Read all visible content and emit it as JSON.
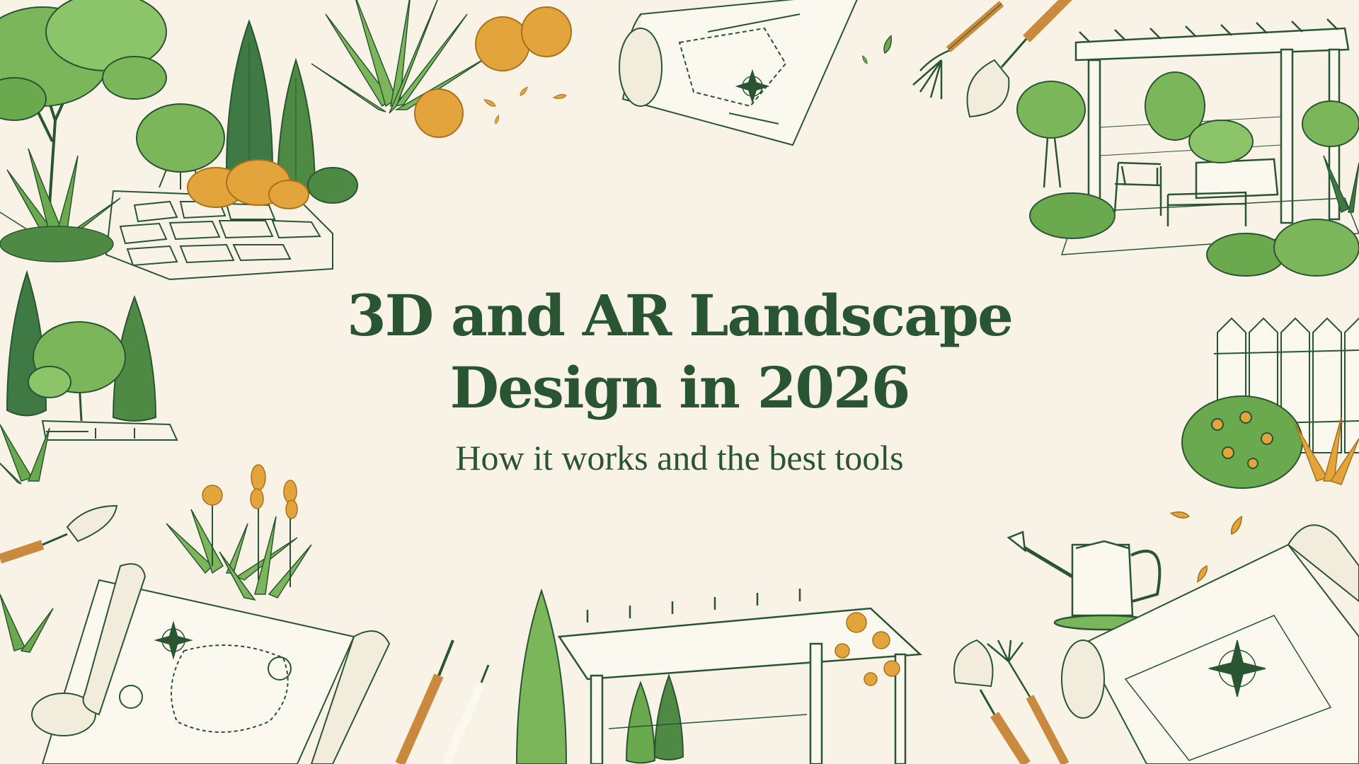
{
  "title": {
    "line1": "3D and AR Landscape",
    "line2": "Design in 2026"
  },
  "subtitle": "How it works and the best tools",
  "colors": {
    "background": "#f8f3e6",
    "ink": "#2a5533",
    "leaf_light": "#7cb65a",
    "leaf_dark": "#3f7a45",
    "marigold": "#e3a53b",
    "wood": "#c98a3d"
  },
  "illustrations": [
    "tree-icon",
    "cypress-icon",
    "shrub-icon",
    "marigold-bush-icon",
    "stone-path-icon",
    "yucca-plant-icon",
    "blueprint-scroll-icon",
    "compass-rose-icon",
    "garden-fork-icon",
    "trowel-icon",
    "pergola-icon",
    "patio-chair-icon",
    "patio-sofa-icon",
    "picket-fence-icon",
    "flower-cluster-icon",
    "watering-can-icon",
    "pencil-icon",
    "paintbrush-icon",
    "falling-leaf-icon"
  ]
}
